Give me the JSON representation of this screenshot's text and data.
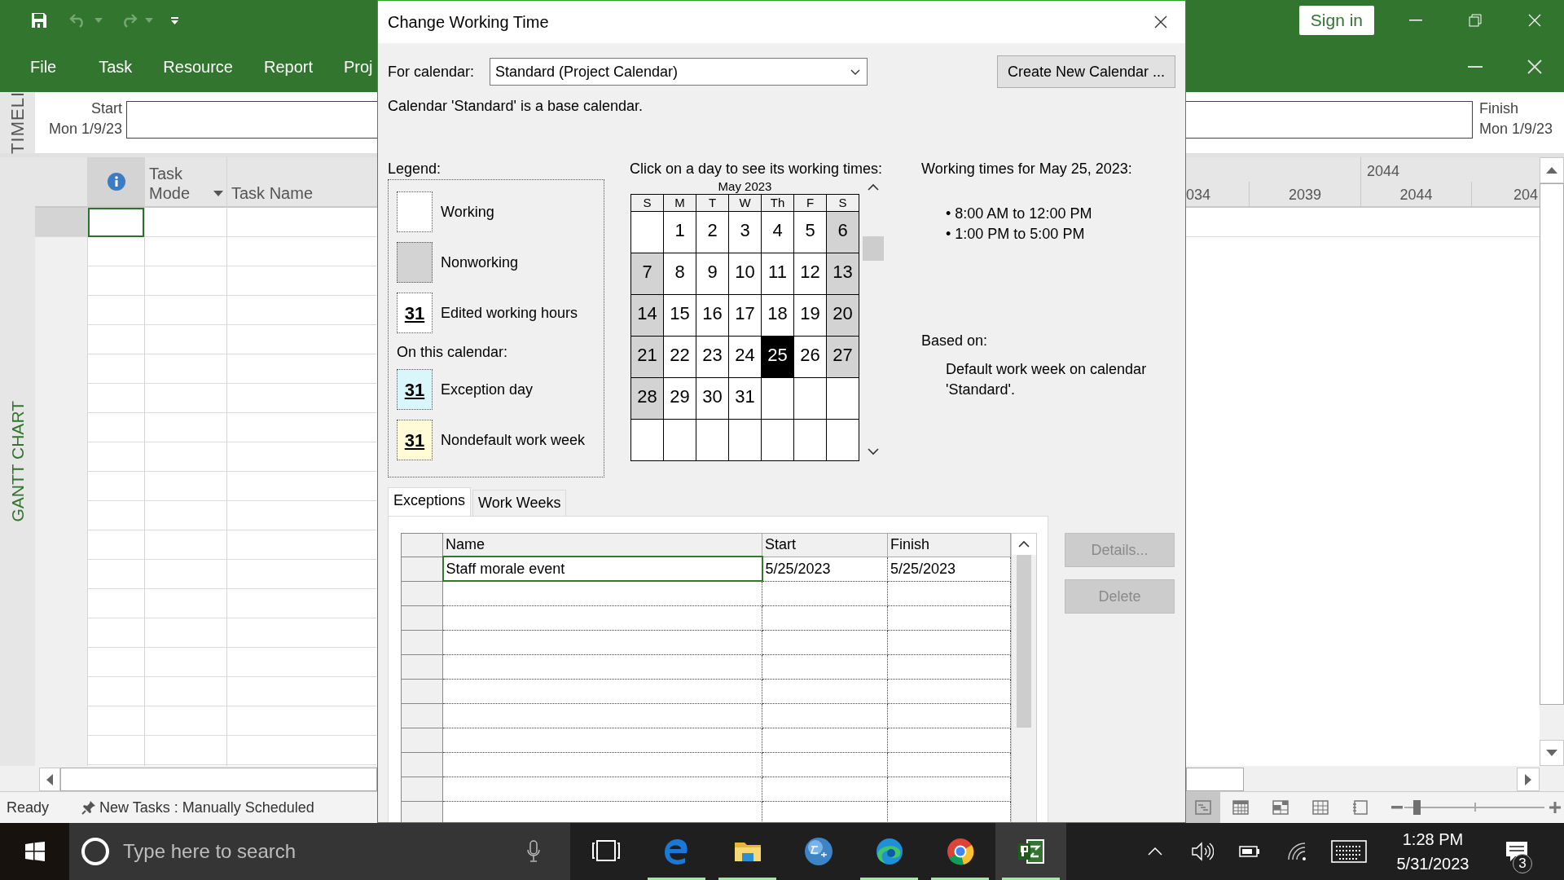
{
  "app": {
    "sign_in": "Sign in",
    "ribbon_tabs": [
      {
        "label": "File"
      },
      {
        "label": "Task"
      },
      {
        "label": "Resource"
      },
      {
        "label": "Report"
      },
      {
        "label": "Proj"
      }
    ],
    "timeline": {
      "side_label": "TIMELI",
      "start_label": "Start",
      "start_date": "Mon 1/9/23",
      "finish_label": "Finish",
      "finish_date": "Mon 1/9/23"
    },
    "gantt": {
      "side_label": "GANTT CHART",
      "task_mode_column": "Task Mode",
      "task_name_column": "Task Name"
    },
    "timescale": {
      "top_tier": [
        "2044"
      ],
      "bottom_tier": [
        "034",
        "2039",
        "2044",
        "204"
      ]
    },
    "status_bar": {
      "mode": "Ready",
      "new_tasks": "New Tasks : Manually Scheduled",
      "zoom_slider": {
        "level": 0.07
      }
    }
  },
  "dialog": {
    "title": "Change Working Time",
    "for_calendar_label": "For calendar:",
    "calendar_value": "Standard (Project Calendar)",
    "create_button": "Create New Calendar ...",
    "note": "Calendar 'Standard' is a base calendar.",
    "legend": {
      "title": "Legend:",
      "items": [
        {
          "kind": "working",
          "label": "Working"
        },
        {
          "kind": "nonworking",
          "label": "Nonworking"
        },
        {
          "kind": "edited",
          "label": "Edited working hours",
          "sample": "31"
        },
        {
          "kind": "heading",
          "label": "On this calendar:"
        },
        {
          "kind": "exception",
          "label": "Exception day",
          "sample": "31"
        },
        {
          "kind": "nondefault",
          "label": "Nondefault work week",
          "sample": "31"
        }
      ]
    },
    "calendar": {
      "prompt": "Click on a day to see its working times:",
      "month": "May 2023",
      "weekdays": [
        "S",
        "M",
        "T",
        "W",
        "Th",
        "F",
        "S"
      ],
      "weeks": [
        [
          {
            "nonworking": false,
            "selected": false
          },
          {
            "day": "1",
            "nonworking": false,
            "selected": false
          },
          {
            "day": "2",
            "nonworking": false,
            "selected": false
          },
          {
            "day": "3",
            "nonworking": false,
            "selected": false
          },
          {
            "day": "4",
            "nonworking": false,
            "selected": false
          },
          {
            "day": "5",
            "nonworking": false,
            "selected": false
          },
          {
            "day": "6",
            "nonworking": true,
            "selected": false
          }
        ],
        [
          {
            "day": "7",
            "nonworking": true,
            "selected": false
          },
          {
            "day": "8",
            "nonworking": false,
            "selected": false
          },
          {
            "day": "9",
            "nonworking": false,
            "selected": false
          },
          {
            "day": "10",
            "nonworking": false,
            "selected": false
          },
          {
            "day": "11",
            "nonworking": false,
            "selected": false
          },
          {
            "day": "12",
            "nonworking": false,
            "selected": false
          },
          {
            "day": "13",
            "nonworking": true,
            "selected": false
          }
        ],
        [
          {
            "day": "14",
            "nonworking": true,
            "selected": false
          },
          {
            "day": "15",
            "nonworking": false,
            "selected": false
          },
          {
            "day": "16",
            "nonworking": false,
            "selected": false
          },
          {
            "day": "17",
            "nonworking": false,
            "selected": false
          },
          {
            "day": "18",
            "nonworking": false,
            "selected": false
          },
          {
            "day": "19",
            "nonworking": false,
            "selected": false
          },
          {
            "day": "20",
            "nonworking": true,
            "selected": false
          }
        ],
        [
          {
            "day": "21",
            "nonworking": true,
            "selected": false
          },
          {
            "day": "22",
            "nonworking": false,
            "selected": false
          },
          {
            "day": "23",
            "nonworking": false,
            "selected": false
          },
          {
            "day": "24",
            "nonworking": false,
            "selected": false
          },
          {
            "day": "25",
            "nonworking": false,
            "selected": true
          },
          {
            "day": "26",
            "nonworking": false,
            "selected": false
          },
          {
            "day": "27",
            "nonworking": true,
            "selected": false
          }
        ],
        [
          {
            "day": "28",
            "nonworking": true,
            "selected": false
          },
          {
            "day": "29",
            "nonworking": false,
            "selected": false
          },
          {
            "day": "30",
            "nonworking": false,
            "selected": false
          },
          {
            "day": "31",
            "nonworking": false,
            "selected": false
          },
          {
            "nonworking": false,
            "selected": false
          },
          {
            "nonworking": false,
            "selected": false
          },
          {
            "nonworking": false,
            "selected": false
          }
        ],
        [
          {
            "nonworking": false,
            "selected": false
          },
          {
            "nonworking": false,
            "selected": false
          },
          {
            "nonworking": false,
            "selected": false
          },
          {
            "nonworking": false,
            "selected": false
          },
          {
            "nonworking": false,
            "selected": false
          },
          {
            "nonworking": false,
            "selected": false
          },
          {
            "nonworking": false,
            "selected": false
          }
        ]
      ]
    },
    "working_times": {
      "title": "Working times for May 25, 2023:",
      "times": [
        "• 8:00 AM to 12:00 PM",
        "• 1:00 PM to 5:00 PM"
      ],
      "based_on_label": "Based on:",
      "based_on_text": "Default work week on calendar 'Standard'."
    },
    "tabs": [
      {
        "label": "Exceptions",
        "selected": true
      },
      {
        "label": "Work Weeks",
        "selected": false
      }
    ],
    "exceptions": {
      "columns": [
        "Name",
        "Start",
        "Finish"
      ],
      "rows": [
        {
          "cells": [
            "Staff morale event",
            "5/25/2023",
            "5/25/2023"
          ],
          "selected": true
        }
      ]
    },
    "buttons": [
      {
        "label": "Details...",
        "disabled": true
      },
      {
        "label": "Delete",
        "disabled": true
      }
    ]
  },
  "taskbar": {
    "search_placeholder": "Type here to search",
    "apps": [
      {
        "kind": "task-view",
        "running": false,
        "selected": false
      },
      {
        "kind": "edge-legacy",
        "running": true,
        "selected": false
      },
      {
        "kind": "explorer",
        "running": true,
        "selected": false
      },
      {
        "kind": "math",
        "running": false,
        "selected": false
      },
      {
        "kind": "edge",
        "running": true,
        "selected": false
      },
      {
        "kind": "chrome",
        "running": true,
        "selected": false
      },
      {
        "kind": "project",
        "running": true,
        "selected": true
      }
    ],
    "time": "1:28 PM",
    "date": "5/31/2023",
    "notification_count": "3"
  }
}
